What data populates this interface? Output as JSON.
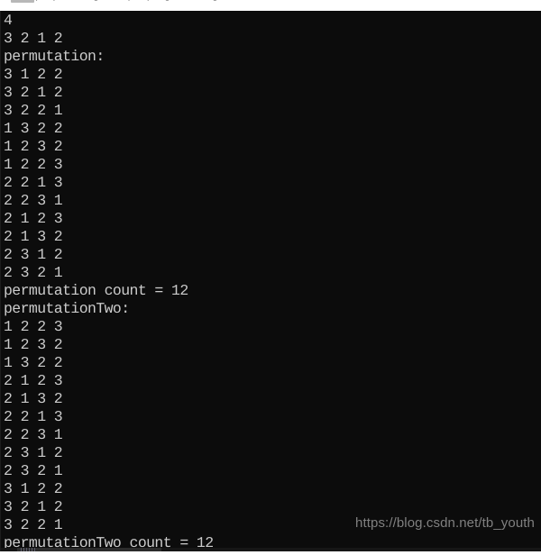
{
  "window": {
    "strip_text_fragment": "         (   q          g       (    (    g           g"
  },
  "console": {
    "background_color": "#0c0c0c",
    "text_color": "#cccccc",
    "lines": [
      "4",
      "3 2 1 2",
      "permutation:",
      "3 1 2 2",
      "3 2 1 2",
      "3 2 2 1",
      "1 3 2 2",
      "1 2 3 2",
      "1 2 2 3",
      "2 2 1 3",
      "2 2 3 1",
      "2 1 2 3",
      "2 1 3 2",
      "2 3 1 2",
      "2 3 2 1",
      "permutation count = 12",
      "permutationTwo:",
      "1 2 2 3",
      "1 2 3 2",
      "1 3 2 2",
      "2 1 2 3",
      "2 1 3 2",
      "2 2 1 3",
      "2 2 3 1",
      "2 3 1 2",
      "2 3 2 1",
      "3 1 2 2",
      "3 2 1 2",
      "3 2 2 1",
      "permutationTwo count = 12"
    ]
  },
  "watermark": {
    "text": "https://blog.csdn.net/tb_youth",
    "color": "#8a8a8a"
  }
}
